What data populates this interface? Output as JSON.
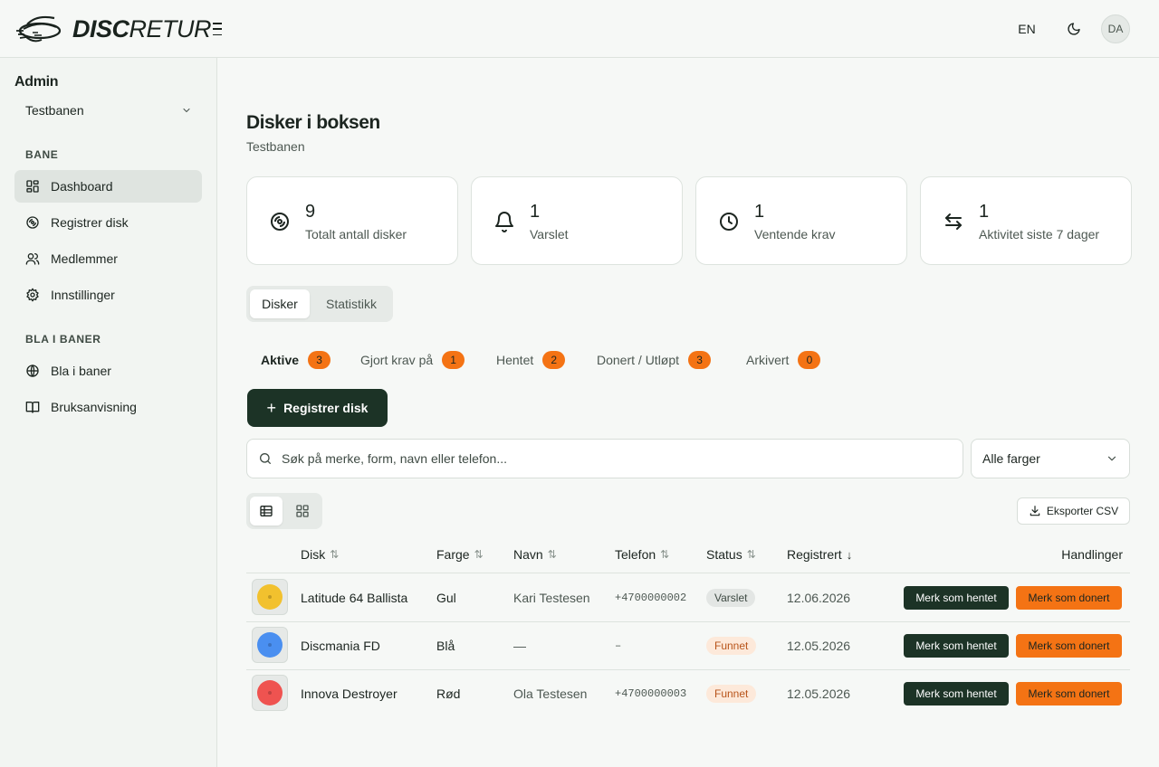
{
  "header": {
    "logo_bold": "DISC",
    "logo_thin": "RETUR",
    "lang": "EN",
    "theme_icon": "moon-icon",
    "avatar": "DA"
  },
  "sidebar": {
    "admin_label": "Admin",
    "course_select": "Testbanen",
    "section_bane": "BANE",
    "items": [
      {
        "label": "Dashboard",
        "icon": "dashboard-icon"
      },
      {
        "label": "Registrer disk",
        "icon": "disc-icon"
      },
      {
        "label": "Medlemmer",
        "icon": "users-icon"
      },
      {
        "label": "Innstillinger",
        "icon": "gear-icon"
      }
    ],
    "section_browse": "BLA I BANER",
    "browse_items": [
      {
        "label": "Bla i baner",
        "icon": "globe-icon"
      },
      {
        "label": "Bruksanvisning",
        "icon": "book-icon"
      }
    ]
  },
  "page": {
    "title": "Disker i boksen",
    "subtitle": "Testbanen"
  },
  "stats": [
    {
      "value": "9",
      "label": "Totalt antall disker",
      "icon": "disc-icon"
    },
    {
      "value": "1",
      "label": "Varslet",
      "icon": "bell-icon"
    },
    {
      "value": "1",
      "label": "Ventende krav",
      "icon": "clock-icon"
    },
    {
      "value": "1",
      "label": "Aktivitet siste 7 dager",
      "icon": "arrows-exchange-icon"
    }
  ],
  "tabs": [
    "Disker",
    "Statistikk"
  ],
  "subtabs": [
    {
      "label": "Aktive",
      "count": "3"
    },
    {
      "label": "Gjort krav på",
      "count": "1"
    },
    {
      "label": "Hentet",
      "count": "2"
    },
    {
      "label": "Donert / Utløpt",
      "count": "3"
    },
    {
      "label": "Arkivert",
      "count": "0"
    }
  ],
  "register_button": "Registrer disk",
  "search": {
    "placeholder": "Søk på merke, form, navn eller telefon..."
  },
  "color_filter": "Alle farger",
  "export_button": "Eksporter CSV",
  "table": {
    "headers": {
      "disk": "Disk",
      "farge": "Farge",
      "navn": "Navn",
      "telefon": "Telefon",
      "status": "Status",
      "registrert": "Registrert",
      "handlinger": "Handlinger"
    },
    "rows": [
      {
        "disc_color": "#f2c12e",
        "disk": "Latitude 64 Ballista",
        "farge": "Gul",
        "navn": "Kari Testesen",
        "telefon": "+4700000002",
        "status": "Varslet",
        "status_kind": "gray",
        "registrert": "12.06.2026",
        "action1": "Merk som hentet",
        "action2": "Merk som donert"
      },
      {
        "disc_color": "#4a8ff0",
        "disk": "Discmania FD",
        "farge": "Blå",
        "navn": "—",
        "telefon": "–",
        "status": "Funnet",
        "status_kind": "orange",
        "registrert": "12.05.2026",
        "action1": "Merk som hentet",
        "action2": "Merk som donert"
      },
      {
        "disc_color": "#ef5350",
        "disk": "Innova Destroyer",
        "farge": "Rød",
        "navn": "Ola Testesen",
        "telefon": "+4700000003",
        "status": "Funnet",
        "status_kind": "orange",
        "registrert": "12.05.2026",
        "action1": "Merk som hentet",
        "action2": "Merk som donert"
      }
    ]
  }
}
